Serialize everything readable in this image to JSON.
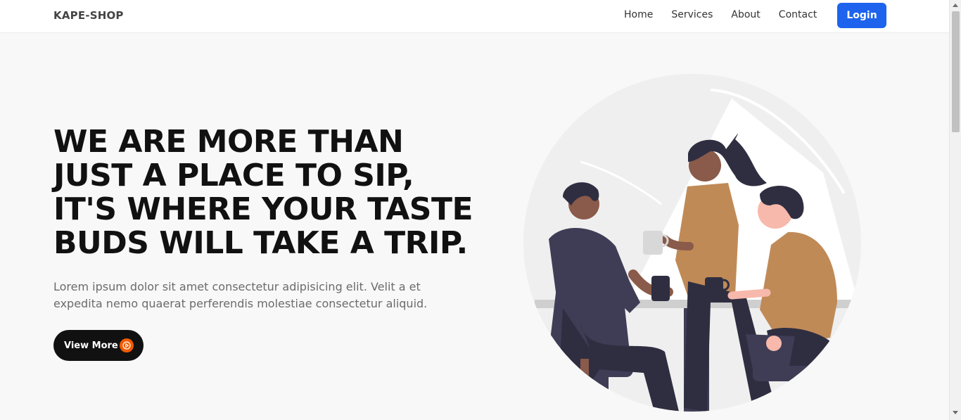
{
  "nav": {
    "brand": "KAPE-SHOP",
    "links": [
      "Home",
      "Services",
      "About",
      "Contact"
    ],
    "login": "Login"
  },
  "hero": {
    "title_lines": [
      "WE ARE MORE THAN",
      "JUST A PLACE TO SIP,",
      "IT'S WHERE YOUR TASTE",
      "BUDS WILL TAKE A TRIP."
    ],
    "text_lines": [
      "Lorem ipsum dolor sit amet consectetur adipisicing elit. Velit a et",
      "expedita nemo quaerat perferendis molestiae consectetur aliquid."
    ],
    "cta": "View More",
    "cta_icon": "play-circle-icon"
  },
  "colors": {
    "accent_blue": "#1d63ed",
    "cta_dark": "#111111",
    "play_orange": "#f05a00",
    "figure_dark": "#3f3d56",
    "figure_brown": "#c08a57"
  }
}
